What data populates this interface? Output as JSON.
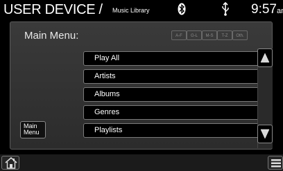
{
  "status_bar": {
    "title": "USER DEVICE /",
    "subtitle": "Music Library",
    "clock": "9:57",
    "clock_suffix": "am",
    "icons": [
      "bluetooth-icon",
      "usb-icon"
    ]
  },
  "panel": {
    "heading": "Main Menu:",
    "alpha_buttons": [
      "A-F",
      "G-L",
      "M-S",
      "T-Z",
      "Oth."
    ]
  },
  "list": {
    "items": [
      "Play All",
      "Artists",
      "Albums",
      "Genres",
      "Playlists"
    ]
  },
  "main_menu_button": {
    "label": "Main\nMenu"
  },
  "scroll": {
    "up_icon": "up-arrow-icon",
    "down_icon": "down-arrow-icon"
  },
  "bottom_bar": {
    "left_icon": "home-icon",
    "right_icon": "menu-icon"
  },
  "colors": {
    "background": "#000000",
    "panel": "#333333",
    "button_border": "#7a7a7a",
    "text": "#ffffff"
  }
}
